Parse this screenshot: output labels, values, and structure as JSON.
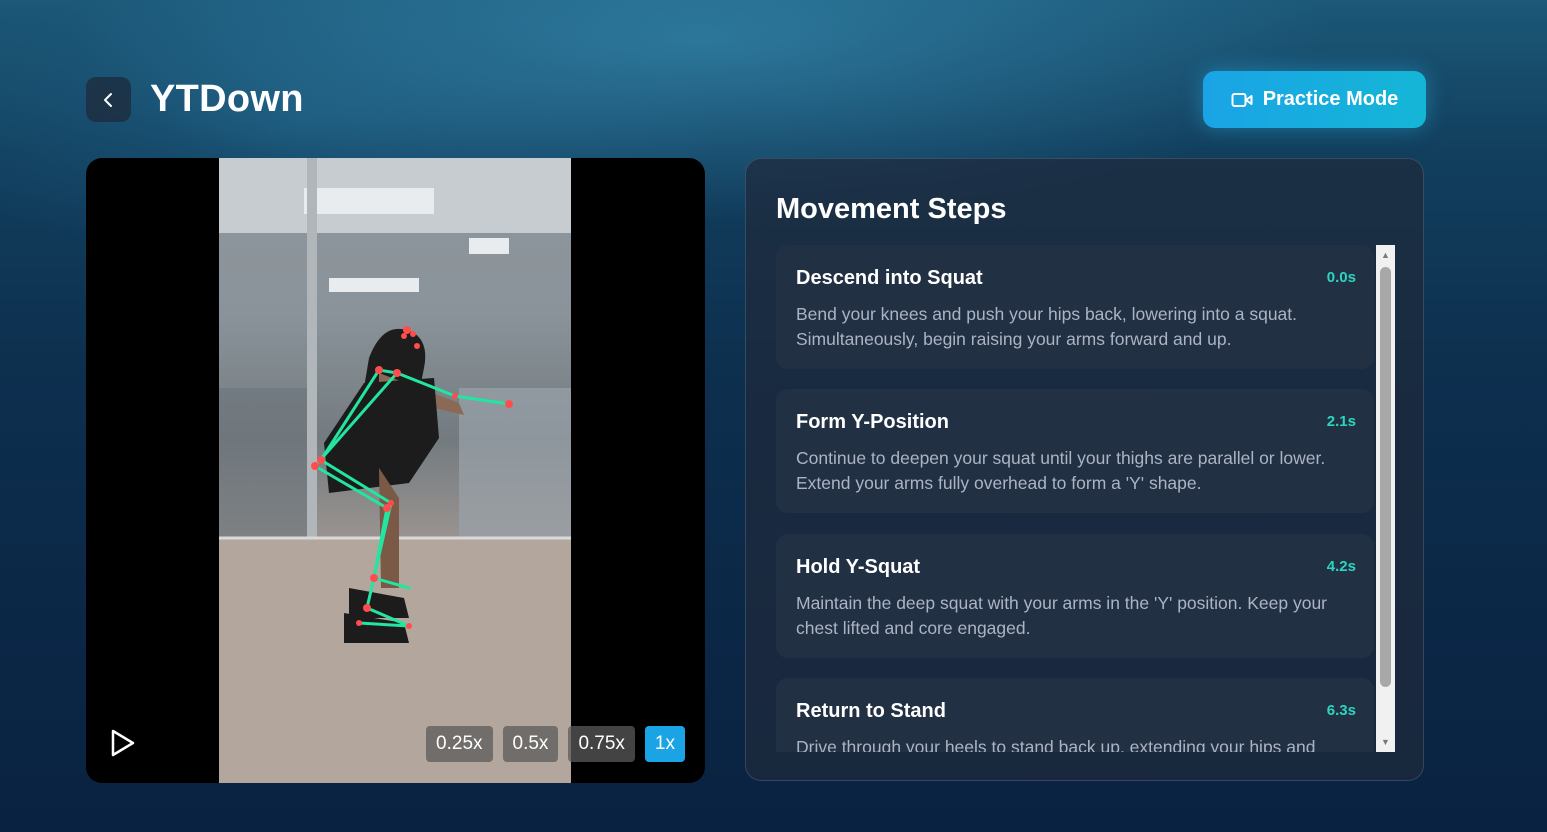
{
  "header": {
    "title": "YTDown",
    "back_icon": "chevron-left-icon",
    "practice_button": {
      "label": "Practice Mode",
      "icon": "video-camera-icon"
    }
  },
  "video": {
    "play_icon": "play-icon",
    "speeds": [
      "0.25x",
      "0.5x",
      "0.75x",
      "1x"
    ],
    "selected_speed": "1x",
    "pose_color": "#22e6a0",
    "joint_color": "#ff4d4d"
  },
  "steps_panel": {
    "title": "Movement Steps",
    "steps": [
      {
        "name": "Descend into Squat",
        "time": "0.0s",
        "description": "Bend your knees and push your hips back, lowering into a squat. Simultaneously, begin raising your arms forward and up."
      },
      {
        "name": "Form Y-Position",
        "time": "2.1s",
        "description": "Continue to deepen your squat until your thighs are parallel or lower. Extend your arms fully overhead to form a 'Y' shape."
      },
      {
        "name": "Hold Y-Squat",
        "time": "4.2s",
        "description": "Maintain the deep squat with your arms in the 'Y' position. Keep your chest lifted and core engaged."
      },
      {
        "name": "Return to Stand",
        "time": "6.3s",
        "description": "Drive through your heels to stand back up, extending your hips and"
      }
    ]
  },
  "colors": {
    "accent": "#1aa4e6",
    "time_color": "#2dd4bf"
  }
}
